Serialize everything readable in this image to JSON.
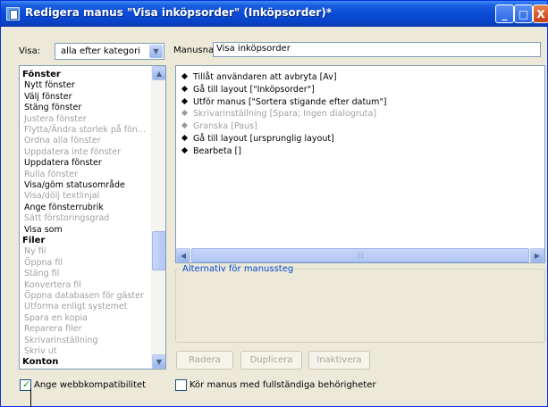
{
  "window": {
    "title": "Redigera manus \"Visa inköpsorder\" (Inköpsorder)*",
    "controls": {
      "minimize": "_",
      "maximize": "□",
      "close": "X"
    }
  },
  "filter": {
    "label": "Visa:",
    "selected": "alla efter kategori"
  },
  "script_name": {
    "label": "Manusnan",
    "value": "Visa inköpsorder"
  },
  "script_list": [
    {
      "text": "Fönster",
      "kind": "category"
    },
    {
      "text": "Nytt fönster",
      "kind": "enabled"
    },
    {
      "text": "Välj fönster",
      "kind": "enabled"
    },
    {
      "text": "Stäng fönster",
      "kind": "enabled"
    },
    {
      "text": "Justera fönster",
      "kind": "disabled"
    },
    {
      "text": "Flytta/Ändra storlek på fön...",
      "kind": "disabled"
    },
    {
      "text": "Ordna alla fönster",
      "kind": "disabled"
    },
    {
      "text": "Uppdatera inte fönster",
      "kind": "disabled"
    },
    {
      "text": "Uppdatera fönster",
      "kind": "enabled"
    },
    {
      "text": "Rulla fönster",
      "kind": "disabled"
    },
    {
      "text": "Visa/göm statusområde",
      "kind": "enabled"
    },
    {
      "text": "Visa/dölj textlinjal",
      "kind": "disabled"
    },
    {
      "text": "Ange fönsterrubrik",
      "kind": "enabled"
    },
    {
      "text": "Sätt förstoringsgrad",
      "kind": "disabled"
    },
    {
      "text": "Visa som",
      "kind": "enabled"
    },
    {
      "text": "Filer",
      "kind": "category"
    },
    {
      "text": "Ny fil",
      "kind": "disabled"
    },
    {
      "text": "Öppna fil",
      "kind": "disabled"
    },
    {
      "text": "Stäng fil",
      "kind": "disabled"
    },
    {
      "text": "Konvertera fil",
      "kind": "disabled"
    },
    {
      "text": "Öppna databasen för gäster",
      "kind": "disabled"
    },
    {
      "text": "Utforma enligt systemet",
      "kind": "disabled"
    },
    {
      "text": "Spara en kopia",
      "kind": "disabled"
    },
    {
      "text": "Reparera filer",
      "kind": "disabled"
    },
    {
      "text": "Skrivarinställning",
      "kind": "disabled"
    },
    {
      "text": "Skriv ut",
      "kind": "disabled"
    },
    {
      "text": "Konton",
      "kind": "category"
    }
  ],
  "script_steps": [
    {
      "text": "Tillåt användaren att avbryta [Av]",
      "enabled": true
    },
    {
      "text": "Gå till layout [\"Inköpsorder\"]",
      "enabled": true
    },
    {
      "text": "Utför manus [\"Sortera stigande efter datum\"]",
      "enabled": true
    },
    {
      "text": "Skrivarinställning [Spara; Ingen dialogruta]",
      "enabled": false
    },
    {
      "text": "Granska [Paus]",
      "enabled": false
    },
    {
      "text": "Gå till layout [ursprunglig layout]",
      "enabled": true
    },
    {
      "text": "Bearbeta []",
      "enabled": true
    }
  ],
  "options": {
    "legend": "Alternativ för manussteg"
  },
  "buttons": {
    "delete": "Radera",
    "duplicate": "Duplicera",
    "disable": "Inaktivera"
  },
  "checkboxes": {
    "web_compat": {
      "label": "Ange webbkompatibilitet",
      "checked": true
    },
    "full_access": {
      "label": "Kör manus med fullständiga behörigheter",
      "checked": false
    }
  },
  "scrollbar_glyphs": {
    "up": "▲",
    "down": "▼",
    "left": "◀",
    "right": "▶",
    "grip": "|||"
  },
  "colors": {
    "title_bar": "#0a4cd6",
    "window_bg": "#ece9d8",
    "legend_text": "#0046d5",
    "disabled_text": "#a0a0a0",
    "checkmark": "#21a121"
  }
}
